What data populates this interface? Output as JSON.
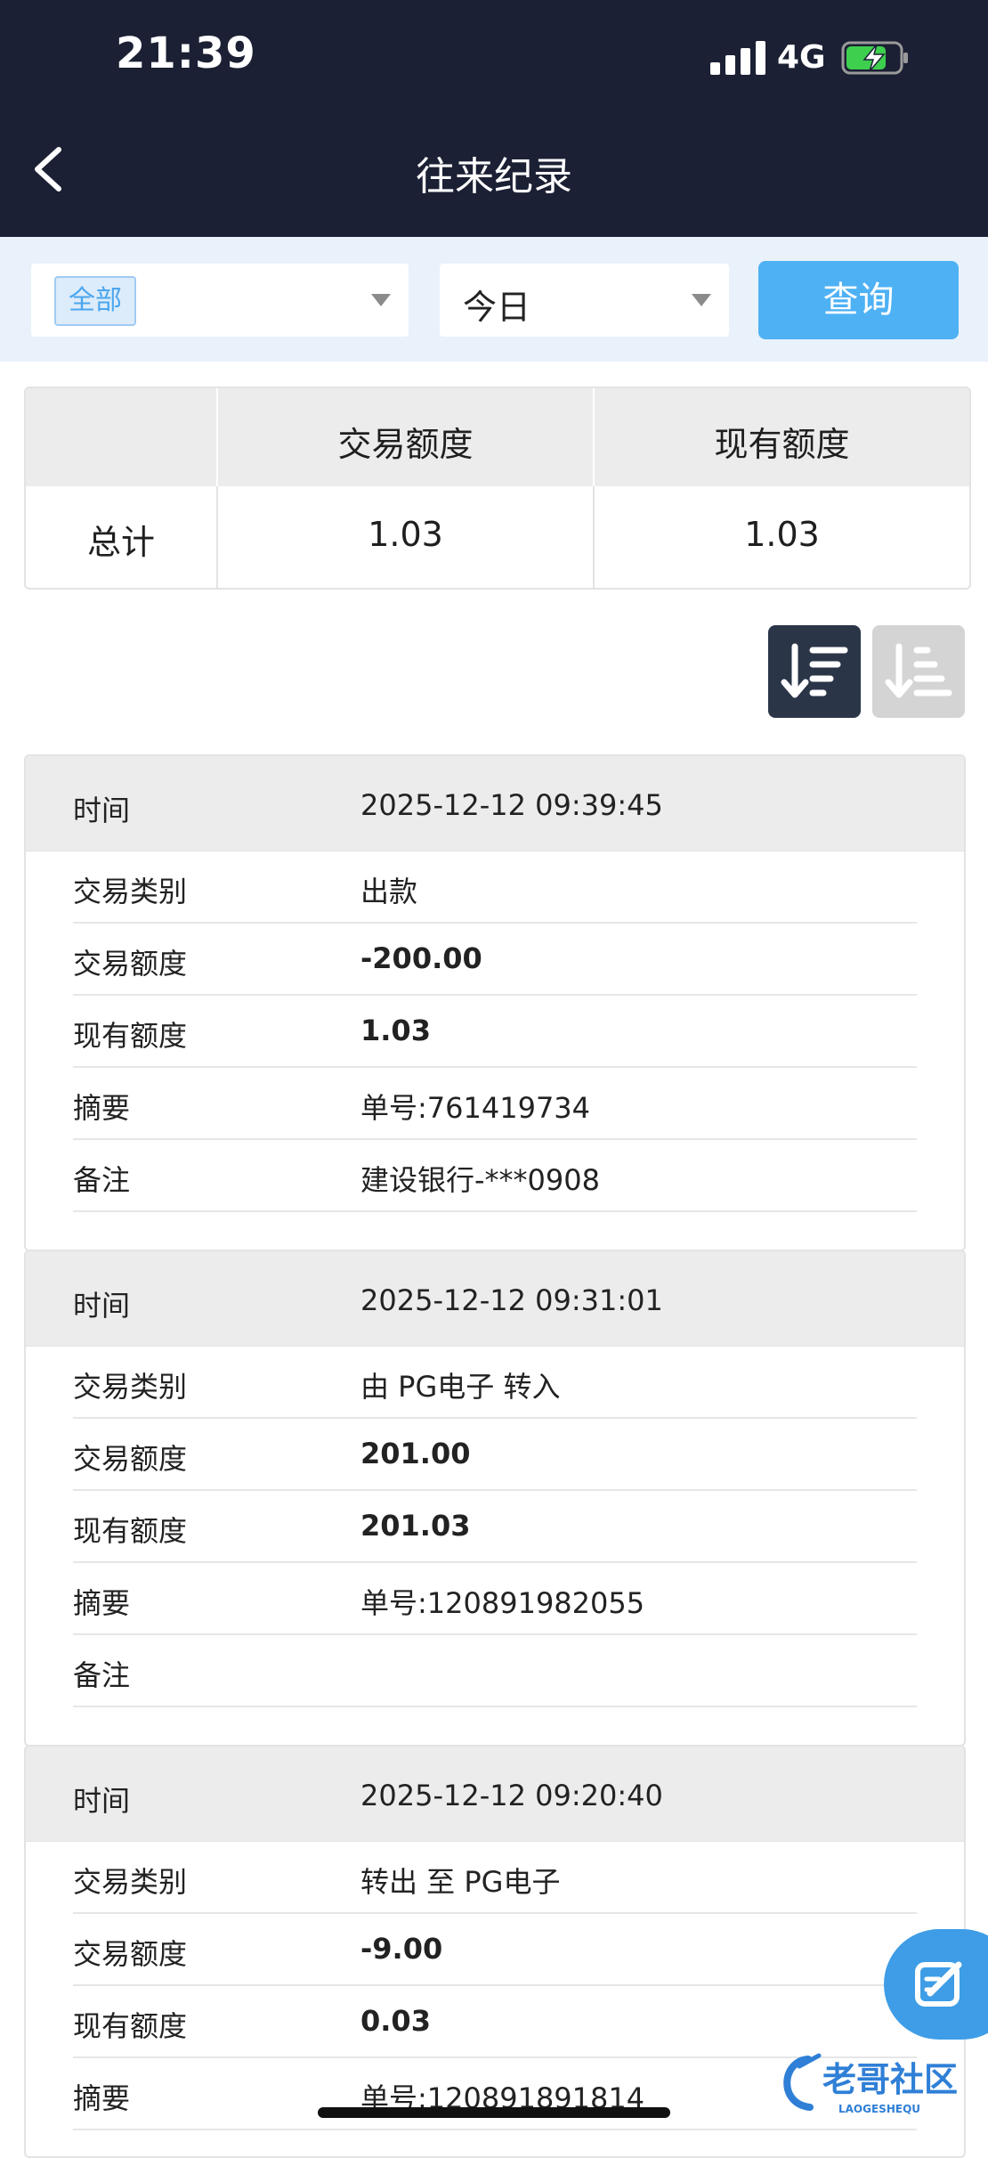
{
  "status_bar": {
    "time": "21:39",
    "network": "4G"
  },
  "header": {
    "title": "往来纪录"
  },
  "filters": {
    "type_value": "全部",
    "date_value": "今日",
    "query_label": "查询"
  },
  "summary": {
    "col_trade": "交易额度",
    "col_balance": "现有额度",
    "row_label": "总计",
    "trade_total": "1.03",
    "balance_total": "1.03"
  },
  "labels": {
    "time": "时间",
    "type": "交易类别",
    "amount": "交易额度",
    "balance": "现有额度",
    "summary": "摘要",
    "note": "备注"
  },
  "records": [
    {
      "time": "2025-12-12 09:39:45",
      "type": "出款",
      "amount": "-200.00",
      "balance": "1.03",
      "summary": "单号:761419734",
      "note": "建设银行-***0908"
    },
    {
      "time": "2025-12-12 09:31:01",
      "type": "由 PG电子 转入",
      "amount": "201.00",
      "balance": "201.03",
      "summary": "单号:120891982055",
      "note": ""
    },
    {
      "time": "2025-12-12 09:20:40",
      "type": "转出 至 PG电子",
      "amount": "-9.00",
      "balance": "0.03",
      "summary": "单号:120891891814",
      "note": ""
    }
  ],
  "watermark": {
    "text": "老哥社区",
    "sub": "LAOGESHEQU"
  },
  "colors": {
    "header_bg": "#1b2034",
    "accent": "#4eb1f4",
    "filter_bg": "#e9f2fb"
  }
}
